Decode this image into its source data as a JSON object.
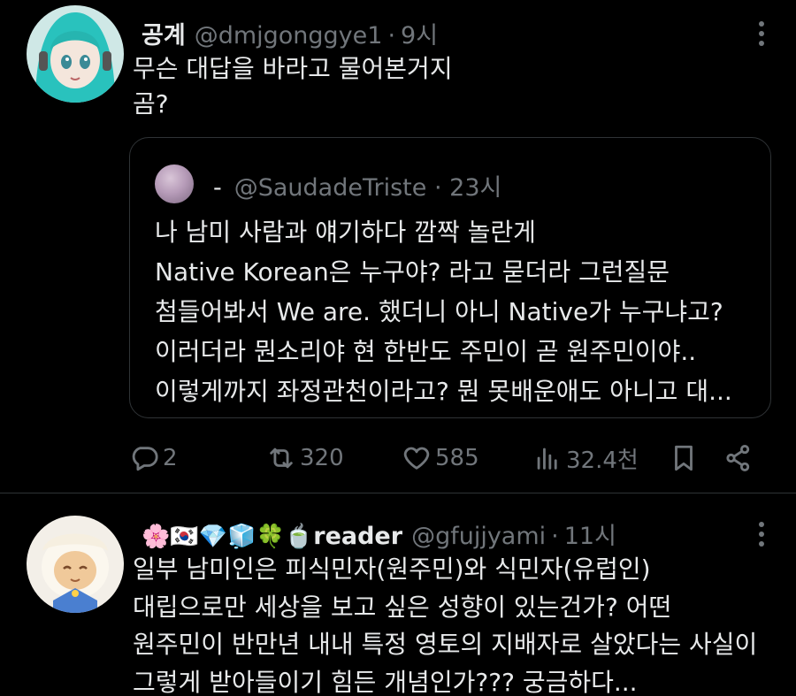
{
  "tweet1": {
    "display_name": "공계",
    "handle": "@dmjgonggye1",
    "separator": "·",
    "time": "9시",
    "text_lines": [
      "무슨 대답을 바라고 물어본거지",
      "곰?"
    ],
    "quote": {
      "display_name": "-",
      "handle": "@SaudadeTriste",
      "separator": "·",
      "time": "23시",
      "text_lines": [
        "나 남미 사람과 얘기하다 깜짝 놀란게",
        "Native Korean은 누구야? 라고 묻더라 그런질문",
        "첨들어봐서 We are. 했더니 아니 Native가 누구냐고?",
        "이러더라 뭔소리야 현 한반도 주민이 곧 원주민이야..",
        "이렇게까지 좌정관천이라고? 뭔 못배운애도 아니고 대..."
      ]
    },
    "actions": {
      "replies": "2",
      "retweets": "320",
      "likes": "585",
      "views": "32.4천"
    }
  },
  "tweet2": {
    "emoji_prefix": "🌸🇰🇷💎🧊🍀🍵",
    "display_name": "reader",
    "handle": "@gfujjyami",
    "separator": "·",
    "time": "11시",
    "text_lines": [
      "일부 남미인은 피식민자(원주민)와 식민자(유럽인)",
      "대립으로만 세상을 보고 싶은 성향이 있는건가? 어떤",
      "원주민이 반만년 내내 특정 영토의 지배자로 살았다는 사실이",
      "그렇게 받아들이기 힘든 개념인가??? 궁금하다..."
    ]
  },
  "icons": {
    "reply": "reply-icon",
    "retweet": "retweet-icon",
    "like": "heart-icon",
    "views": "views-icon",
    "bookmark": "bookmark-icon",
    "share": "share-icon",
    "more": "more-icon"
  },
  "colors": {
    "background": "#000000",
    "text": "#e7e9ea",
    "muted": "#71767b",
    "border": "#2f3336"
  }
}
